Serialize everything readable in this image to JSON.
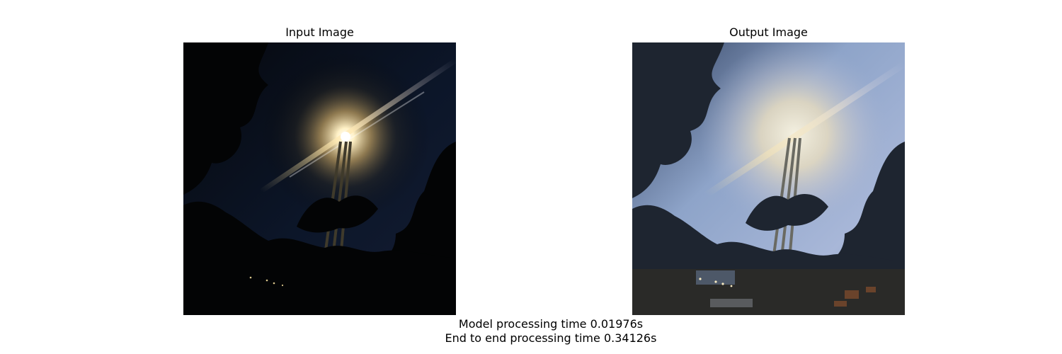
{
  "panels": [
    {
      "title": "Input Image"
    },
    {
      "title": "Output Image"
    }
  ],
  "captions": {
    "model_time": "Model processing time 0.01976s",
    "end_to_end_time": "End to end processing time 0.34126s"
  },
  "colors": {
    "background": "#ffffff",
    "text": "#000000",
    "input_sky": "#0b1424",
    "output_sky": "#8fa3c8",
    "light_glow": "#f3dfa6"
  }
}
